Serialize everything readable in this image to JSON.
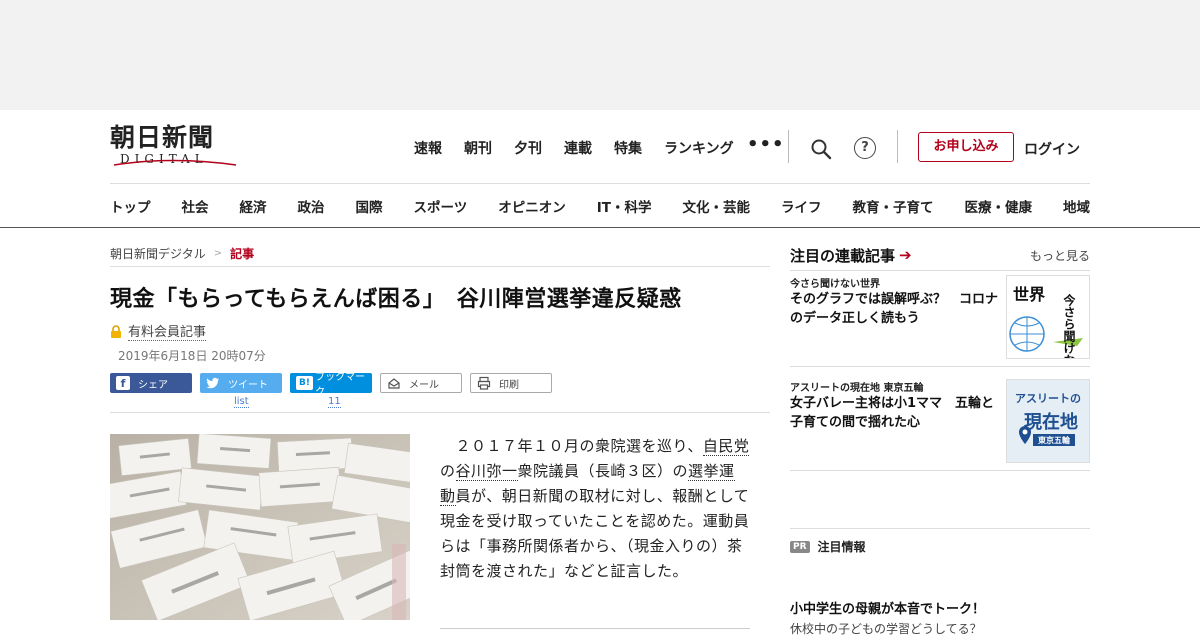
{
  "logo": {
    "main": "朝日新聞",
    "sub": "DIGITAL"
  },
  "topnav": [
    "速報",
    "朝刊",
    "夕刊",
    "連載",
    "特集",
    "ランキング"
  ],
  "more_dots": "•••",
  "help_label": "?",
  "apply_label": "お申し込み",
  "login_label": "ログイン",
  "categories": [
    "トップ",
    "社会",
    "経済",
    "政治",
    "国際",
    "スポーツ",
    "オピニオン",
    "IT・科学",
    "文化・芸能",
    "ライフ",
    "教育・子育て",
    "医療・健康",
    "地域"
  ],
  "breadcrumb": {
    "home": "朝日新聞デジタル",
    "sep": ">",
    "current": "記事"
  },
  "article": {
    "headline": "現金「もらってもらえんば困る」　谷川陣営選挙違反疑惑",
    "paid_label": "有料会員記事",
    "date": "2019年6月18日 20時07分",
    "body_lines": [
      {
        "text": "　２０１７年１０月の衆院選を巡り、"
      },
      {
        "link": "自民"
      }
    ],
    "body": {
      "p1": "　２０１７年１０月の衆院選を巡り、",
      "l1": "自民党",
      "p2": "の",
      "l2": "谷川弥一",
      "p3": "衆院議員（長崎３区）の",
      "l3": "選挙運動",
      "p4": "員が、朝日新聞の取材に対し、報酬として現金を受け取っていたことを認めた。運動員らは「事務所関係者から、（現金入りの）茶封筒を渡された」などと証言した。"
    }
  },
  "share": {
    "facebook": "シェア",
    "twitter": "ツイート",
    "twitter_count": "list",
    "hatena": "ブックマーク",
    "hatena_count": "11",
    "mail": "メール",
    "print": "印刷"
  },
  "sidebar": {
    "heading": "注目の連載記事",
    "heading_arrow": "➔",
    "more": "もっと見る",
    "cards": [
      {
        "category": "今さら聞けない世界",
        "title": "そのグラフでは誤解呼ぶ？　コロナのデータ正しく読もう",
        "thumb_text_a": "世界",
        "thumb_text_b": "今さら聞けない"
      },
      {
        "category": "アスリートの現在地 東京五輪",
        "title": "女子バレー主将は小1ママ　五輪と子育ての間で揺れた心",
        "thumb_text_a": "アスリートの",
        "thumb_text_b": "現在地",
        "thumb_text_c": "東京五輪"
      }
    ],
    "pr_tag": "PR",
    "pr_heading": "注目情報",
    "pr_title": "小中学生の母親が本音でトーク！",
    "pr_sub": "休校中の子どもの学習どうしてる？"
  },
  "colors": {
    "brand": "#b3001b",
    "facebook": "#3b5998",
    "twitter": "#55acee",
    "hatena": "#008fde"
  }
}
